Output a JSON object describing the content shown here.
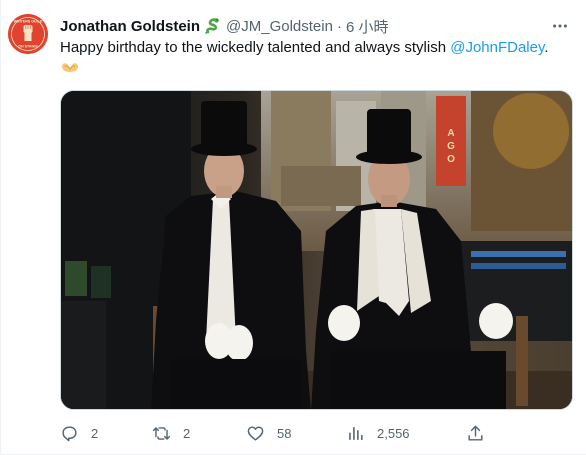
{
  "tweet": {
    "author": {
      "display_name": "Jonathan Goldstein",
      "handle": "@JM_Goldstein",
      "badge_icon": "snake-emoji-icon",
      "avatar": {
        "icon": "raised-fist-logo",
        "background": "#e0442f",
        "logo_text_top": "WRITERS GUILD",
        "logo_text_bottom": "ON STRIKE"
      }
    },
    "separator": "·",
    "timestamp": "6 小時",
    "text_before_mention": "Happy birthday to the wickedly talented and always stylish ",
    "mention": "@JohnFDaley",
    "text_after_mention": ".",
    "emoji": "heart-hands-emoji-icon",
    "more_icon": "more-horizontal-icon",
    "photo": {
      "description_icon": "two-men-in-top-hats-photo"
    },
    "actions": {
      "reply": {
        "icon": "reply-icon",
        "count": "2"
      },
      "retweet": {
        "icon": "retweet-icon",
        "count": "2"
      },
      "like": {
        "icon": "heart-icon",
        "count": "58"
      },
      "views": {
        "icon": "views-chart-icon",
        "count": "2,556"
      },
      "share": {
        "icon": "share-icon"
      }
    },
    "colors": {
      "text": "#0f1419",
      "secondary": "#536471",
      "link": "#1d9bf0",
      "border": "#cfd9de"
    }
  }
}
